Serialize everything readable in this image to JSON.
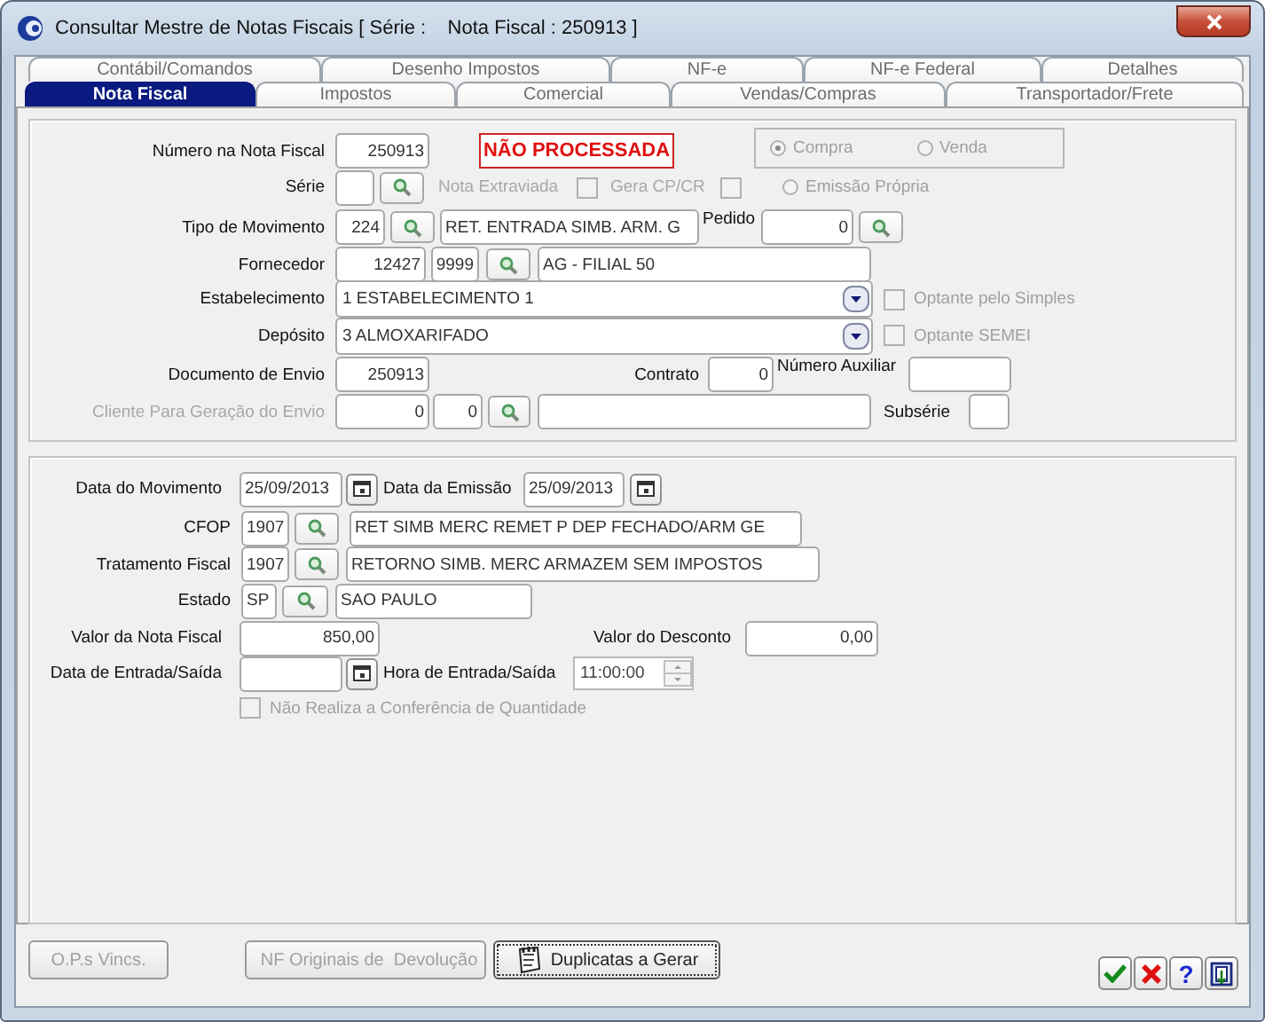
{
  "window": {
    "title": "Consultar Mestre de Notas Fiscais [ Série :    Nota Fiscal : 250913 ]"
  },
  "tabs_back": [
    {
      "label": "Contábil/Comandos",
      "selected": false
    },
    {
      "label": "Desenho Impostos",
      "selected": false
    },
    {
      "label": "NF-e",
      "selected": false
    },
    {
      "label": "NF-e Federal",
      "selected": false
    },
    {
      "label": "Detalhes",
      "selected": false
    }
  ],
  "tabs_front": [
    {
      "label": "Nota Fiscal",
      "selected": true
    },
    {
      "label": "Impostos",
      "selected": false
    },
    {
      "label": "Comercial",
      "selected": false
    },
    {
      "label": "Vendas/Compras",
      "selected": false
    },
    {
      "label": "Transportador/Frete",
      "selected": false
    }
  ],
  "header_form": {
    "rows": [
      {
        "items": [
          {
            "kind": "label",
            "text": "Número na Nota Fiscal",
            "disabled": false
          },
          {
            "kind": "field",
            "value": "250913"
          },
          {
            "kind": "status",
            "text": "NÃO PROCESSADA"
          },
          {
            "kind": "radio_group",
            "options": [
              {
                "label": "Compra",
                "selected": true,
                "disabled": true
              },
              {
                "label": "Venda",
                "selected": false,
                "disabled": true
              }
            ]
          }
        ]
      },
      {
        "items": [
          {
            "kind": "label",
            "text": "Série",
            "disabled": false
          },
          {
            "kind": "field",
            "value": ""
          },
          {
            "kind": "lookup"
          },
          {
            "kind": "label",
            "text": "Nota Extraviada",
            "disabled": true
          },
          {
            "kind": "checkbox",
            "checked": false,
            "disabled": true
          },
          {
            "kind": "label",
            "text": "Gera CP/CR",
            "disabled": true
          },
          {
            "kind": "checkbox",
            "checked": false,
            "disabled": true
          },
          {
            "kind": "radio",
            "label": "Emissão Própria",
            "selected": false,
            "disabled": true
          }
        ]
      },
      {
        "items": [
          {
            "kind": "label",
            "text": "Tipo de Movimento",
            "disabled": false
          },
          {
            "kind": "field",
            "value": "224"
          },
          {
            "kind": "lookup"
          },
          {
            "kind": "field",
            "value": "RET. ENTRADA SIMB. ARM. G"
          },
          {
            "kind": "label",
            "text": "Pedido",
            "disabled": false
          },
          {
            "kind": "field",
            "value": "0"
          },
          {
            "kind": "lookup"
          }
        ]
      },
      {
        "items": [
          {
            "kind": "label",
            "text": "Fornecedor",
            "disabled": false
          },
          {
            "kind": "field",
            "value": "12427"
          },
          {
            "kind": "field",
            "value": "9999"
          },
          {
            "kind": "lookup"
          },
          {
            "kind": "field",
            "value": "AG - FILIAL 50"
          }
        ]
      },
      {
        "items": [
          {
            "kind": "label",
            "text": "Estabelecimento",
            "disabled": false
          },
          {
            "kind": "combo",
            "value": "1 ESTABELECIMENTO 1"
          },
          {
            "kind": "checkbox",
            "label": "Optante pelo Simples",
            "checked": false,
            "disabled": true
          }
        ]
      },
      {
        "items": [
          {
            "kind": "label",
            "text": "Depósito",
            "disabled": false
          },
          {
            "kind": "combo",
            "value": "3 ALMOXARIFADO"
          },
          {
            "kind": "checkbox",
            "label": "Optante SEMEI",
            "checked": false,
            "disabled": true
          }
        ]
      },
      {
        "items": [
          {
            "kind": "label",
            "text": "Documento de Envio",
            "disabled": false
          },
          {
            "kind": "field",
            "value": "250913"
          },
          {
            "kind": "label",
            "text": "Contrato",
            "disabled": false
          },
          {
            "kind": "field",
            "value": "0"
          },
          {
            "kind": "label",
            "text": "Número Auxiliar",
            "disabled": false
          },
          {
            "kind": "field",
            "value": ""
          }
        ]
      },
      {
        "items": [
          {
            "kind": "label",
            "text": "Cliente Para Geração do Envio",
            "disabled": true
          },
          {
            "kind": "field",
            "value": "0"
          },
          {
            "kind": "field",
            "value": "0"
          },
          {
            "kind": "lookup"
          },
          {
            "kind": "field",
            "value": ""
          },
          {
            "kind": "label",
            "text": "Subsérie",
            "disabled": false
          },
          {
            "kind": "field",
            "value": ""
          }
        ]
      }
    ]
  },
  "dates_form": {
    "rows": [
      {
        "items": [
          {
            "kind": "label",
            "text": "Data do Movimento",
            "disabled": false
          },
          {
            "kind": "field",
            "value": "25/09/2013"
          },
          {
            "kind": "calendar"
          },
          {
            "kind": "label",
            "text": "Data da Emissão",
            "disabled": false
          },
          {
            "kind": "field",
            "value": "25/09/2013"
          },
          {
            "kind": "calendar"
          }
        ]
      },
      {
        "items": [
          {
            "kind": "label",
            "text": "CFOP",
            "disabled": false
          },
          {
            "kind": "field",
            "value": "1907"
          },
          {
            "kind": "lookup"
          },
          {
            "kind": "field",
            "value": "RET SIMB MERC REMET P DEP FECHADO/ARM GE"
          }
        ]
      },
      {
        "items": [
          {
            "kind": "label",
            "text": "Tratamento Fiscal",
            "disabled": false
          },
          {
            "kind": "field",
            "value": "1907"
          },
          {
            "kind": "lookup"
          },
          {
            "kind": "field",
            "value": "RETORNO SIMB. MERC ARMAZEM SEM IMPOSTOS"
          }
        ]
      },
      {
        "items": [
          {
            "kind": "label",
            "text": "Estado",
            "disabled": false
          },
          {
            "kind": "field",
            "value": "SP"
          },
          {
            "kind": "lookup"
          },
          {
            "kind": "field",
            "value": "SAO PAULO"
          }
        ]
      },
      {
        "items": [
          {
            "kind": "label",
            "text": "Valor da Nota Fiscal",
            "disabled": false
          },
          {
            "kind": "field",
            "value": "850,00"
          },
          {
            "kind": "label",
            "text": "Valor do Desconto",
            "disabled": false
          },
          {
            "kind": "field",
            "value": "0,00"
          }
        ]
      },
      {
        "items": [
          {
            "kind": "label",
            "text": "Data de Entrada/Saída",
            "disabled": false
          },
          {
            "kind": "field",
            "value": ""
          },
          {
            "kind": "calendar"
          },
          {
            "kind": "label",
            "text": "Hora de Entrada/Saída",
            "disabled": false
          },
          {
            "kind": "time",
            "value": "11:00:00"
          }
        ]
      },
      {
        "items": [
          {
            "kind": "checkbox",
            "label": "Não Realiza a Conferência de Quantidade",
            "checked": false,
            "disabled": true
          }
        ]
      }
    ]
  },
  "bottom_buttons": [
    {
      "kind": "plain",
      "label": "O.P.s Vincs.",
      "disabled": true,
      "focused": false
    },
    {
      "kind": "book",
      "label": "NF Originais de  Devolução",
      "disabled": true,
      "focused": false
    },
    {
      "kind": "notepad",
      "label": "Duplicatas a Gerar",
      "disabled": false,
      "focused": true
    }
  ],
  "action_buttons": [
    {
      "kind": "confirm"
    },
    {
      "kind": "cancel"
    },
    {
      "kind": "help",
      "label": "?"
    },
    {
      "kind": "exit"
    }
  ]
}
